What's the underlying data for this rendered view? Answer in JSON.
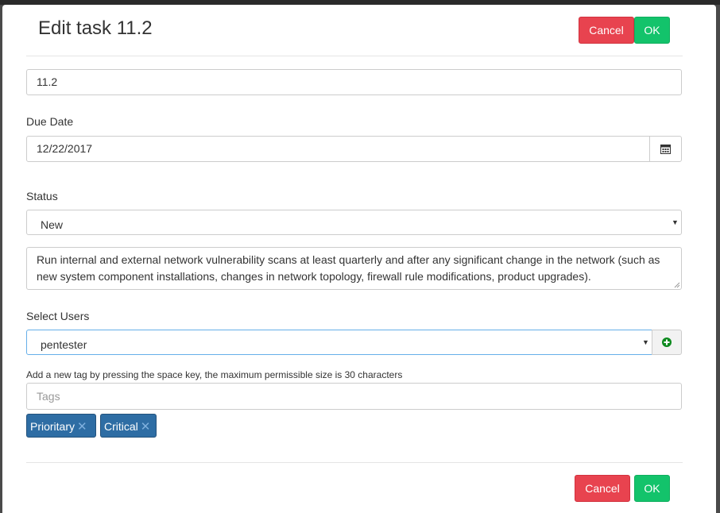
{
  "header": {
    "title": "Edit task 11.2",
    "cancel_label": "Cancel",
    "ok_label": "OK"
  },
  "form": {
    "task_name_value": "11.2",
    "due_date_label": "Due Date",
    "due_date_value": "12/22/2017",
    "status_label": "Status",
    "status_value": "New",
    "description_value": "Run internal and external network vulnerability scans at least quarterly and after any significant change in the network (such as new system component installations, changes in network topology, firewall rule modifications, product upgrades).",
    "users_label": "Select Users",
    "users_value": "pentester",
    "tags_hint": "Add a new tag by pressing the space key, the maximum permissible size is 30 characters",
    "tags_placeholder": "Tags",
    "tags": [
      "Prioritary",
      "Critical"
    ]
  },
  "footer": {
    "cancel_label": "Cancel",
    "ok_label": "OK"
  },
  "icons": {
    "calendar": "calendar-icon",
    "add": "plus-circle-icon",
    "remove": "close-icon",
    "dropdown": "caret-down-icon"
  },
  "colors": {
    "cancel": "#e8434f",
    "ok": "#13c36b",
    "tag": "#2e6da4",
    "focus_border": "#66afe9"
  }
}
